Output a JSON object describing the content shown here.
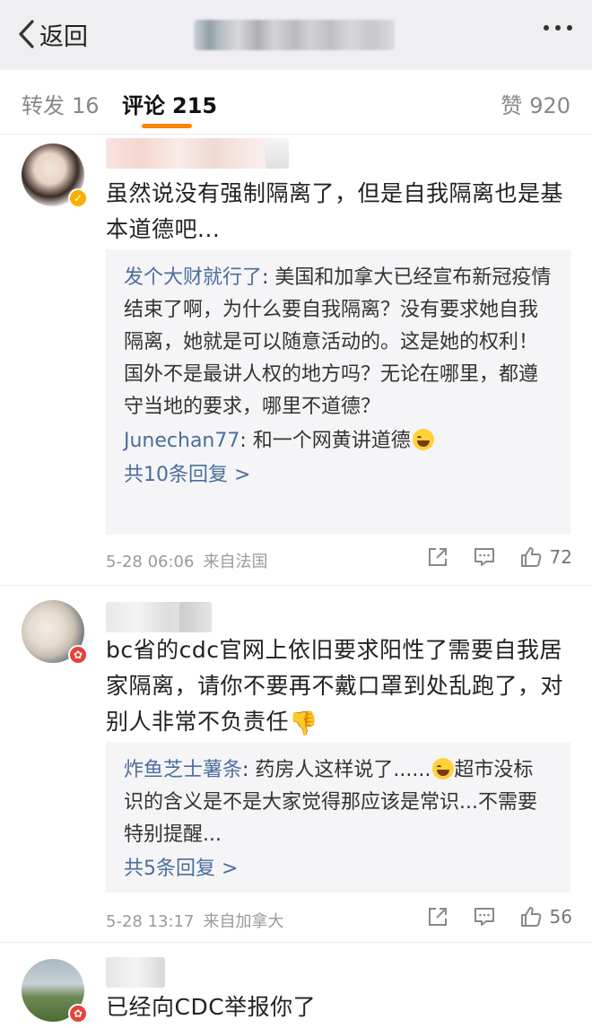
{
  "header": {
    "back_label": "返回",
    "back_icon": "chevron-left-icon",
    "more_icon": "more-icon"
  },
  "tabs": {
    "repost_label": "转发",
    "repost_count": "16",
    "comments_label": "评论",
    "comments_count": "215",
    "likes_label": "赞",
    "likes_count": "920",
    "active_color": "#ff8200"
  },
  "comments": [
    {
      "badge": "gold-verified-badge",
      "text": "虽然说没有强制隔离了，但是自我隔离也是基本道德吧...",
      "replies": [
        {
          "name": "发个大财就行了",
          "text": ": 美国和加拿大已经宣布新冠疫情结束了啊，为什么要自我隔离？没有要求她自我隔离，她就是可以随意活动的。这是她的权利！国外不是最讲人权的地方吗？无论在哪里，都遵守当地的要求，哪里不道德？"
        },
        {
          "name": "Junechan77",
          "text": ": 和一个网黄讲道德",
          "emoji": "laugh-cry-emoji"
        }
      ],
      "more_replies": "共10条回复 >",
      "time": "5-28 06:06",
      "location": "来自法国",
      "likes": "72"
    },
    {
      "badge": "red-badge",
      "text": "bc省的cdc官网上依旧要求阳性了需要自我居家隔离，请你不要再不戴口罩到处乱跑了，对别人非常不负责任",
      "text_emoji": "thumbs-down-emoji",
      "replies": [
        {
          "name": "炸鱼芝士薯条",
          "text": ": 药房人这样说了......",
          "emoji": "laugh-cry-emoji",
          "text_after": "超市没标识的含义是不是大家觉得那应该是常识...不需要特别提醒..."
        }
      ],
      "more_replies": "共5条回复 >",
      "time": "5-28 13:17",
      "location": "来自加拿大",
      "likes": "56"
    },
    {
      "badge": "red-badge",
      "text": "已经向CDC举报你了"
    }
  ],
  "colors": {
    "link_blue": "#4b6e9b",
    "reply_bg": "#f5f5f7",
    "accent_orange": "#ff8200"
  }
}
